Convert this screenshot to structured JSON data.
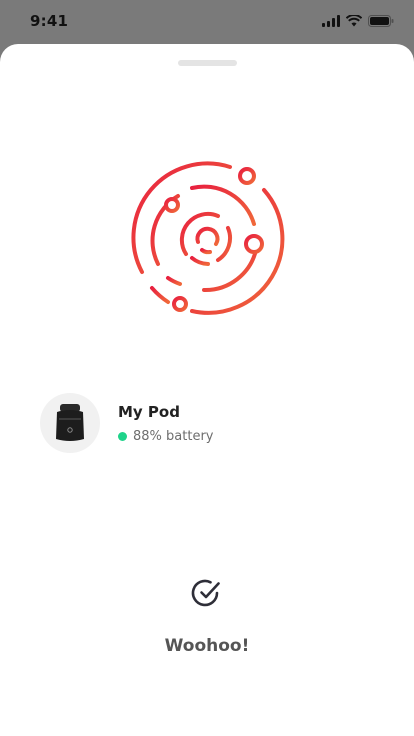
{
  "status_bar": {
    "time": "9:41"
  },
  "device": {
    "name": "My Pod",
    "battery_text": "88% battery",
    "battery_color": "#1fd38a"
  },
  "success_message": "Woohoo!",
  "colors": {
    "logo_gradient_start": "#e8203f",
    "logo_gradient_end": "#f0683a"
  },
  "icons": {
    "logo": "orbit-logo-icon",
    "device": "pod-device-icon",
    "success": "check-circle-icon"
  }
}
